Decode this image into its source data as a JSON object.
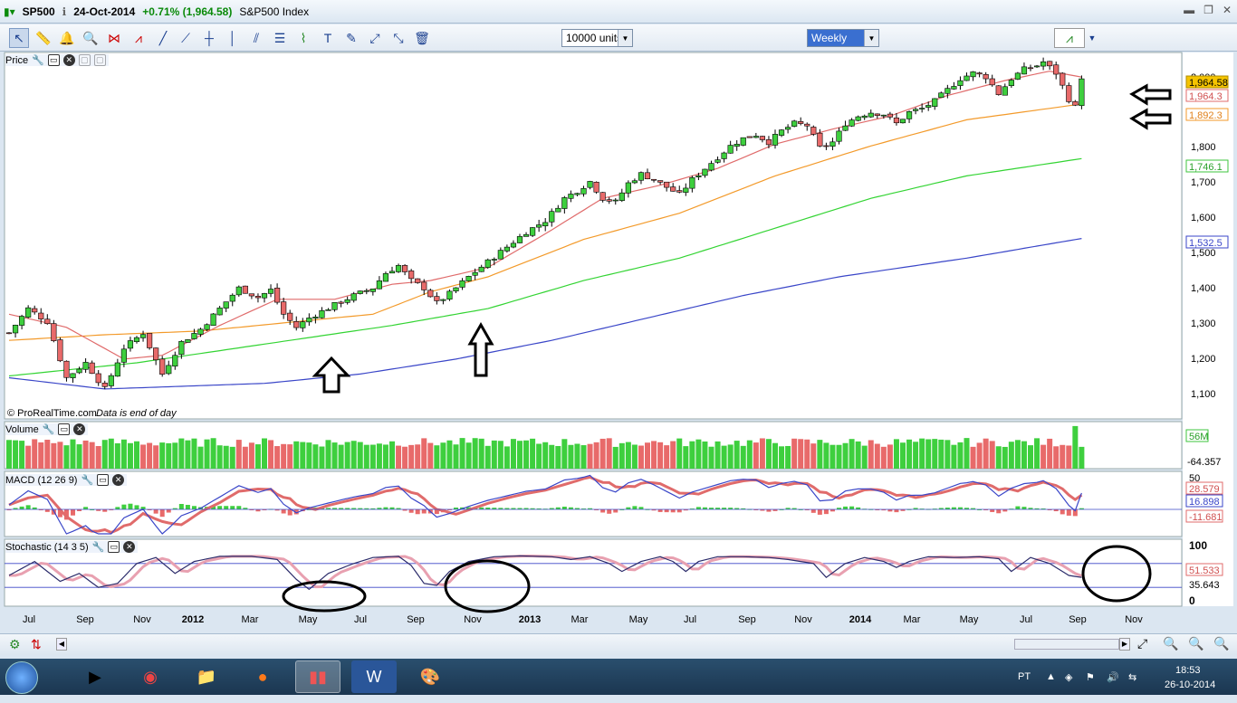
{
  "window": {
    "symbol": "SP500",
    "date": "24-Oct-2014",
    "change": "+0.71% (1,964.58)",
    "instrument": "S&P500 Index"
  },
  "toolbar": {
    "units_select": "10000 units",
    "period_select": "Weekly"
  },
  "panels": {
    "price_label": "Price",
    "price_footer": "© ProRealTime.com",
    "price_footer_note": "Data is end of day",
    "volume_label": "Volume",
    "macd_label": "MACD (12 26 9)",
    "stoch_label": "Stochastic (14 3 5)"
  },
  "price_axis": {
    "ticks": [
      "2,000",
      "1,800",
      "1,700",
      "1,600",
      "1,500",
      "1,400",
      "1,300",
      "1,200",
      "1,100"
    ],
    "last_price_tag": "1,964.58",
    "ma20_tag": "1,964.3",
    "ma50_tag": "1,892.3",
    "ma100_tag": "1,746.1",
    "ma200_tag": "1,532.5"
  },
  "volume_axis": {
    "tag": "56M",
    "low": "-64.357"
  },
  "macd_axis": {
    "top": "50",
    "tag1": "28.579",
    "tag2": "16.898",
    "tag3": "-11.681"
  },
  "stoch_axis": {
    "top": "100",
    "tag1": "51.533",
    "tag2": "35.643",
    "bottom": "0"
  },
  "x_axis": {
    "labels": [
      "Jul",
      "Sep",
      "Nov",
      "2012",
      "Mar",
      "May",
      "Jul",
      "Sep",
      "Nov",
      "2013",
      "Mar",
      "May",
      "Jul",
      "Sep",
      "Nov",
      "2014",
      "Mar",
      "May",
      "Jul",
      "Sep",
      "Nov"
    ]
  },
  "taskbar": {
    "lang": "PT",
    "time": "18:53",
    "date": "26-10-2014"
  },
  "chart_data": {
    "type": "candlestick",
    "title": "SP500 S&P500 Index",
    "period": "Weekly",
    "ylim": [
      1050,
      2030
    ],
    "x_labels": [
      "Jul",
      "Sep",
      "Nov",
      "2012",
      "Mar",
      "May",
      "Jul",
      "Sep",
      "Nov",
      "2013",
      "Mar",
      "May",
      "Jul",
      "Sep",
      "Nov",
      "2014",
      "Mar",
      "May",
      "Jul",
      "Sep",
      "Nov"
    ],
    "price_path": [
      [
        0,
        1280
      ],
      [
        3,
        1345
      ],
      [
        6,
        1310
      ],
      [
        9,
        1160
      ],
      [
        12,
        1200
      ],
      [
        15,
        1130
      ],
      [
        18,
        1240
      ],
      [
        21,
        1280
      ],
      [
        24,
        1170
      ],
      [
        27,
        1255
      ],
      [
        30,
        1290
      ],
      [
        33,
        1345
      ],
      [
        36,
        1400
      ],
      [
        39,
        1375
      ],
      [
        41,
        1395
      ],
      [
        43,
        1330
      ],
      [
        45,
        1295
      ],
      [
        47,
        1320
      ],
      [
        51,
        1355
      ],
      [
        54,
        1380
      ],
      [
        57,
        1400
      ],
      [
        59,
        1440
      ],
      [
        61,
        1460
      ],
      [
        63,
        1420
      ],
      [
        65,
        1400
      ],
      [
        67,
        1360
      ],
      [
        69,
        1385
      ],
      [
        72,
        1430
      ],
      [
        75,
        1470
      ],
      [
        78,
        1510
      ],
      [
        81,
        1550
      ],
      [
        84,
        1580
      ],
      [
        87,
        1640
      ],
      [
        89,
        1660
      ],
      [
        91,
        1685
      ],
      [
        93,
        1640
      ],
      [
        95,
        1630
      ],
      [
        97,
        1680
      ],
      [
        99,
        1705
      ],
      [
        101,
        1690
      ],
      [
        103,
        1670
      ],
      [
        105,
        1650
      ],
      [
        107,
        1690
      ],
      [
        109,
        1720
      ],
      [
        111,
        1750
      ],
      [
        113,
        1780
      ],
      [
        115,
        1800
      ],
      [
        117,
        1810
      ],
      [
        119,
        1790
      ],
      [
        121,
        1820
      ],
      [
        123,
        1840
      ],
      [
        125,
        1835
      ],
      [
        127,
        1775
      ],
      [
        129,
        1790
      ],
      [
        131,
        1840
      ],
      [
        133,
        1860
      ],
      [
        135,
        1870
      ],
      [
        137,
        1865
      ],
      [
        139,
        1840
      ],
      [
        141,
        1870
      ],
      [
        143,
        1880
      ],
      [
        145,
        1900
      ],
      [
        147,
        1930
      ],
      [
        149,
        1960
      ],
      [
        151,
        1975
      ],
      [
        153,
        1965
      ],
      [
        155,
        1920
      ],
      [
        157,
        1960
      ],
      [
        159,
        1985
      ],
      [
        161,
        1995
      ],
      [
        162,
        2005
      ],
      [
        164,
        1975
      ],
      [
        166,
        1905
      ],
      [
        167,
        1884
      ],
      [
        168,
        1964.58
      ]
    ],
    "ma20": [
      [
        0,
        1330
      ],
      [
        9,
        1295
      ],
      [
        18,
        1210
      ],
      [
        24,
        1220
      ],
      [
        33,
        1300
      ],
      [
        42,
        1370
      ],
      [
        51,
        1370
      ],
      [
        60,
        1410
      ],
      [
        66,
        1420
      ],
      [
        75,
        1455
      ],
      [
        84,
        1545
      ],
      [
        93,
        1640
      ],
      [
        102,
        1675
      ],
      [
        111,
        1720
      ],
      [
        120,
        1785
      ],
      [
        129,
        1825
      ],
      [
        138,
        1860
      ],
      [
        147,
        1915
      ],
      [
        156,
        1955
      ],
      [
        163,
        1980
      ],
      [
        168,
        1964.3
      ]
    ],
    "ma50": [
      [
        0,
        1260
      ],
      [
        15,
        1275
      ],
      [
        30,
        1285
      ],
      [
        45,
        1310
      ],
      [
        57,
        1330
      ],
      [
        66,
        1390
      ],
      [
        75,
        1430
      ],
      [
        90,
        1530
      ],
      [
        105,
        1600
      ],
      [
        120,
        1700
      ],
      [
        135,
        1780
      ],
      [
        150,
        1850
      ],
      [
        168,
        1892.3
      ]
    ],
    "ma100": [
      [
        0,
        1165
      ],
      [
        20,
        1200
      ],
      [
        40,
        1250
      ],
      [
        60,
        1300
      ],
      [
        75,
        1345
      ],
      [
        90,
        1420
      ],
      [
        105,
        1480
      ],
      [
        120,
        1560
      ],
      [
        135,
        1640
      ],
      [
        150,
        1700
      ],
      [
        168,
        1746.1
      ]
    ],
    "ma200": [
      [
        0,
        1160
      ],
      [
        15,
        1130
      ],
      [
        40,
        1145
      ],
      [
        55,
        1170
      ],
      [
        70,
        1210
      ],
      [
        85,
        1260
      ],
      [
        100,
        1320
      ],
      [
        115,
        1380
      ],
      [
        130,
        1430
      ],
      [
        150,
        1480
      ],
      [
        168,
        1532.5
      ]
    ],
    "stochastic": [
      [
        0,
        50
      ],
      [
        4,
        85
      ],
      [
        8,
        35
      ],
      [
        11,
        55
      ],
      [
        14,
        20
      ],
      [
        17,
        30
      ],
      [
        20,
        80
      ],
      [
        23,
        95
      ],
      [
        26,
        55
      ],
      [
        29,
        85
      ],
      [
        33,
        98
      ],
      [
        38,
        98
      ],
      [
        42,
        90
      ],
      [
        45,
        40
      ],
      [
        47,
        15
      ],
      [
        50,
        55
      ],
      [
        54,
        80
      ],
      [
        57,
        95
      ],
      [
        61,
        98
      ],
      [
        63,
        75
      ],
      [
        65,
        30
      ],
      [
        67,
        25
      ],
      [
        69,
        60
      ],
      [
        72,
        85
      ],
      [
        76,
        97
      ],
      [
        80,
        99
      ],
      [
        85,
        97
      ],
      [
        88,
        90
      ],
      [
        91,
        97
      ],
      [
        94,
        80
      ],
      [
        96,
        60
      ],
      [
        99,
        85
      ],
      [
        102,
        97
      ],
      [
        104,
        85
      ],
      [
        106,
        60
      ],
      [
        108,
        85
      ],
      [
        111,
        97
      ],
      [
        115,
        97
      ],
      [
        119,
        95
      ],
      [
        122,
        90
      ],
      [
        126,
        80
      ],
      [
        128,
        45
      ],
      [
        131,
        80
      ],
      [
        134,
        95
      ],
      [
        137,
        85
      ],
      [
        139,
        70
      ],
      [
        141,
        85
      ],
      [
        144,
        97
      ],
      [
        148,
        95
      ],
      [
        152,
        97
      ],
      [
        155,
        92
      ],
      [
        157,
        60
      ],
      [
        160,
        95
      ],
      [
        163,
        80
      ],
      [
        166,
        50
      ],
      [
        168,
        45
      ]
    ]
  }
}
